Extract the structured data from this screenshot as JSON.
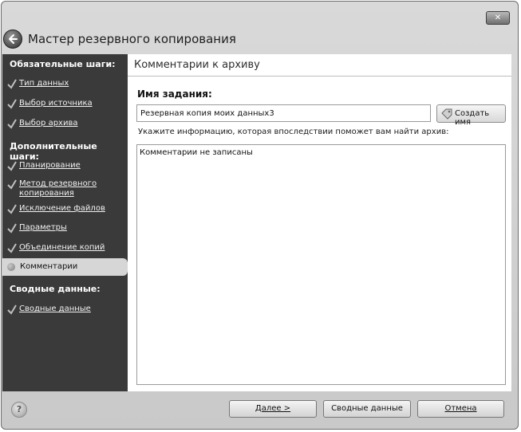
{
  "window": {
    "title": "Мастер резервного копирования",
    "close_label": "✕"
  },
  "sidebar": {
    "required_title": "Обязательные шаги:",
    "required_items": [
      {
        "label": "Тип данных"
      },
      {
        "label": "Выбор источника"
      },
      {
        "label": "Выбор архива"
      }
    ],
    "optional_title": "Дополнительные шаги:",
    "optional_items": [
      {
        "label": "Планирование"
      },
      {
        "label": "Метод резервного копирования"
      },
      {
        "label": "Исключение файлов"
      },
      {
        "label": "Параметры"
      },
      {
        "label": "Объединение копий"
      }
    ],
    "current_item": {
      "label": "Комментарии"
    },
    "summary_title": "Сводные данные:",
    "summary_items": [
      {
        "label": "Сводные данные"
      }
    ]
  },
  "main": {
    "section_title": "Комментарии к архиву",
    "job_name_label": "Имя задания:",
    "job_name_value": "Резервная копия моих данных3",
    "create_name_button": "Создать имя",
    "hint_text": "Укажите информацию, которая впоследствии поможет вам найти архив:",
    "comments_value": "Комментарии не записаны"
  },
  "footer": {
    "help_label": "?",
    "next_button": "Далее >",
    "summary_button": "Сводные данные",
    "cancel_button": "Отмена"
  }
}
